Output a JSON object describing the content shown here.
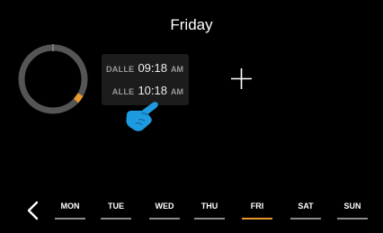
{
  "header": {
    "title": "Friday"
  },
  "schedule": {
    "from_label": "DALLE",
    "from_time": "09:18",
    "from_ampm": "AM",
    "to_label": "ALLE",
    "to_time": "10:18",
    "to_ampm": "AM"
  },
  "ring": {
    "track_color": "#555555",
    "accent_color": "#e89a2c"
  },
  "icons": {
    "add": "plus-icon",
    "hint": "pointing-hand-icon",
    "back": "chevron-left-icon"
  },
  "days": [
    {
      "label": "MON",
      "active": false
    },
    {
      "label": "TUE",
      "active": false
    },
    {
      "label": "WED",
      "active": false
    },
    {
      "label": "THU",
      "active": false
    },
    {
      "label": "FRI",
      "active": true
    },
    {
      "label": "SAT",
      "active": false
    },
    {
      "label": "SUN",
      "active": false
    }
  ],
  "colors": {
    "background": "#000000",
    "active_day": "#e89a2c",
    "inactive_day": "#8a8a8a",
    "hand": "#1e9be0"
  }
}
